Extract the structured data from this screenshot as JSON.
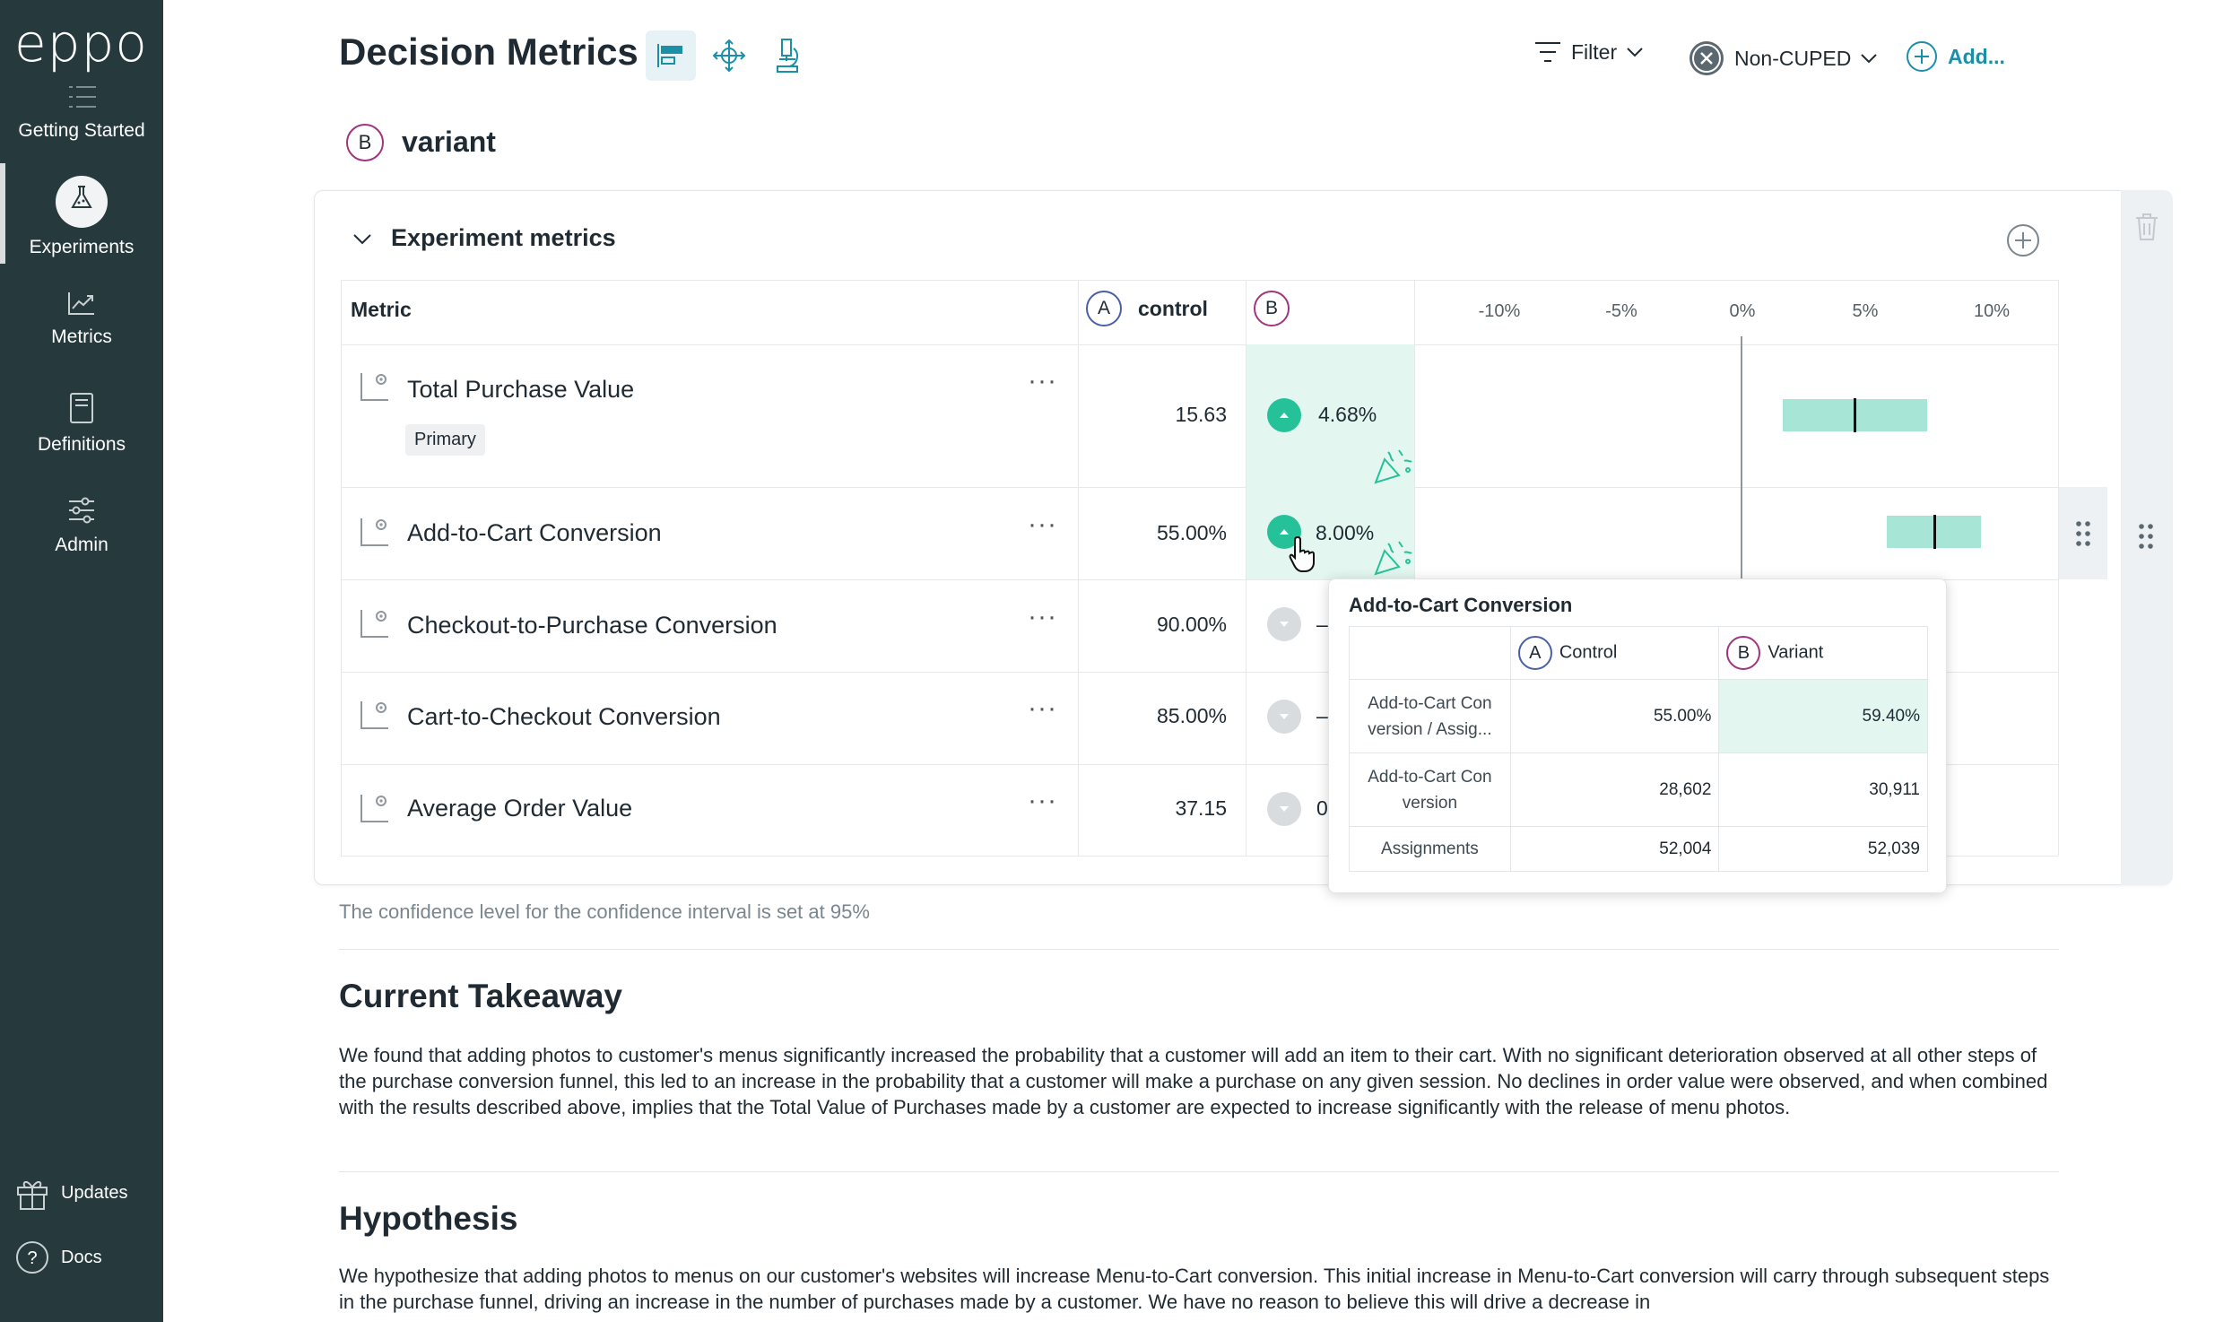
{
  "app": {
    "logo": "eppo"
  },
  "sidebar": {
    "items": [
      {
        "label": "Getting Started",
        "icon": "list-icon"
      },
      {
        "label": "Experiments",
        "icon": "flask-icon",
        "active": true
      },
      {
        "label": "Metrics",
        "icon": "trend-chart-icon"
      },
      {
        "label": "Definitions",
        "icon": "book-icon"
      },
      {
        "label": "Admin",
        "icon": "sliders-icon"
      }
    ],
    "bottom": [
      {
        "label": "Updates",
        "icon": "gift-icon"
      },
      {
        "label": "Docs",
        "icon": "help-circle-icon"
      }
    ]
  },
  "header": {
    "title": "Decision Metrics",
    "filter_label": "Filter",
    "cuped_label": "Non-CUPED",
    "add_label": "Add..."
  },
  "variant": {
    "badge": "B",
    "name": "variant"
  },
  "metrics_section": {
    "title": "Experiment metrics",
    "columns": {
      "metric": "Metric",
      "control_badge": "A",
      "control": "control",
      "variant_badge": "B"
    },
    "axis_ticks": [
      "-10%",
      "-5%",
      "0%",
      "5%",
      "10%"
    ],
    "rows": [
      {
        "name": "Total Purchase Value",
        "tag": "Primary",
        "control": "15.63",
        "lift": "4.68%",
        "significant": true
      },
      {
        "name": "Add-to-Cart Conversion",
        "control": "55.00%",
        "lift": "8.00%",
        "significant": true
      },
      {
        "name": "Checkout-to-Purchase Conversion",
        "control": "90.00%",
        "lift": "–",
        "significant": false
      },
      {
        "name": "Cart-to-Checkout Conversion",
        "control": "85.00%",
        "lift": "–",
        "significant": false
      },
      {
        "name": "Average Order Value",
        "control": "37.15",
        "lift": "0",
        "significant": false
      }
    ]
  },
  "tooltip": {
    "title": "Add-to-Cart Conversion",
    "control_badge": "A",
    "control_label": "Control",
    "variant_badge": "B",
    "variant_label": "Variant",
    "rows": [
      {
        "label": "Add-to-Cart Con version / Assig...",
        "control": "55.00%",
        "variant": "59.40%"
      },
      {
        "label": "Add-to-Cart Con version",
        "control": "28,602",
        "variant": "30,911"
      },
      {
        "label": "Assignments",
        "control": "52,004",
        "variant": "52,039"
      }
    ]
  },
  "confidence_note": "The confidence level for the confidence interval is set at 95%",
  "takeaway": {
    "heading": "Current Takeaway",
    "body": "We found that adding photos to customer's menus significantly increased the probability that a customer will add an item to their cart. With no significant deterioration observed at all other steps of the purchase conversion funnel, this led to an increase in the probability that a customer will make a purchase on any given session. No declines in order value were observed, and when combined with the results described above, implies that the Total Value of Purchases made by a customer are expected to increase significantly with the release of menu photos."
  },
  "hypothesis": {
    "heading": "Hypothesis",
    "body": "We hypothesize that adding photos to menus on our customer's websites will increase Menu-to-Cart conversion. This initial increase in Menu-to-Cart conversion will carry through subsequent steps in the purchase funnel, driving an increase in the number of purchases made by a customer. We have no reason to believe this will drive a decrease in"
  },
  "colors": {
    "sidebar": "#26393d",
    "accent": "#1b8fa8",
    "significant": "#25c29a",
    "ci_fill": "#a7e6d7",
    "lift_bg": "#e3f6f0",
    "variant_badge": "#a0357c",
    "control_badge": "#4a5fa8"
  }
}
